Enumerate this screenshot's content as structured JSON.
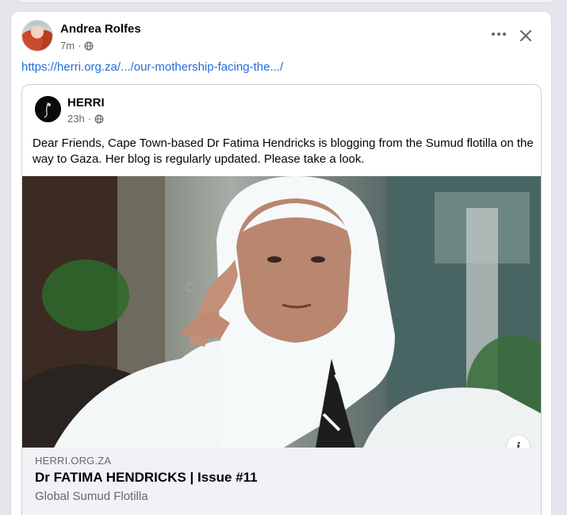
{
  "post": {
    "author": "Andrea Rolfes",
    "time": "7m",
    "separator": "·",
    "link": "https://herri.org.za/.../our-mothership-facing-the.../"
  },
  "shared": {
    "page_name": "HERRI",
    "time": "23h",
    "separator": "·",
    "text": "Dear Friends, Cape Town-based Dr Fatima Hendricks is blogging from the Sumud flotilla on the way to Gaza. Her blog is regularly updated. Please take a look.",
    "info_label": "i"
  },
  "link_preview": {
    "domain": "HERRI.ORG.ZA",
    "title": "Dr FATIMA HENDRICKS | Issue #11",
    "subtitle": "Global Sumud Flotilla"
  },
  "icons": {
    "privacy": "globe-icon",
    "more": "more-options-icon",
    "close": "close-icon",
    "info": "info-icon"
  },
  "colors": {
    "link": "#216fdb",
    "secondary_text": "#65676b",
    "preview_bg": "#f0f2f5"
  }
}
